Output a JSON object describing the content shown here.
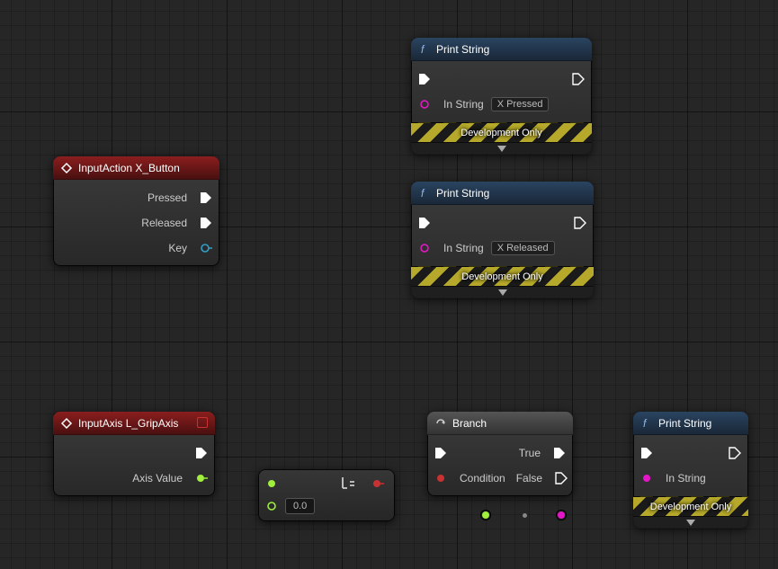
{
  "colors": {
    "exec": "#ffffff",
    "float": "#9fef3c",
    "bool": "#c83232",
    "string": "#e616c8",
    "key": "#30a0c8"
  },
  "nodes": {
    "inputAction": {
      "title": "InputAction X_Button",
      "pins": {
        "pressed": "Pressed",
        "released": "Released",
        "key": "Key"
      }
    },
    "inputAxis": {
      "title": "InputAxis L_GripAxis",
      "pins": {
        "axisValue": "Axis Value"
      }
    },
    "printString1": {
      "title": "Print String",
      "pins": {
        "inString": "In String",
        "inStringValue": "X Pressed"
      },
      "footer": "Development Only"
    },
    "printString2": {
      "title": "Print String",
      "pins": {
        "inString": "In String",
        "inStringValue": "X Released"
      },
      "footer": "Development Only"
    },
    "printString3": {
      "title": "Print String",
      "pins": {
        "inString": "In String"
      },
      "footer": "Development Only"
    },
    "branch": {
      "title": "Branch",
      "pins": {
        "condition": "Condition",
        "true": "True",
        "false": "False"
      }
    },
    "compare": {
      "defaultValue": "0.0"
    }
  }
}
